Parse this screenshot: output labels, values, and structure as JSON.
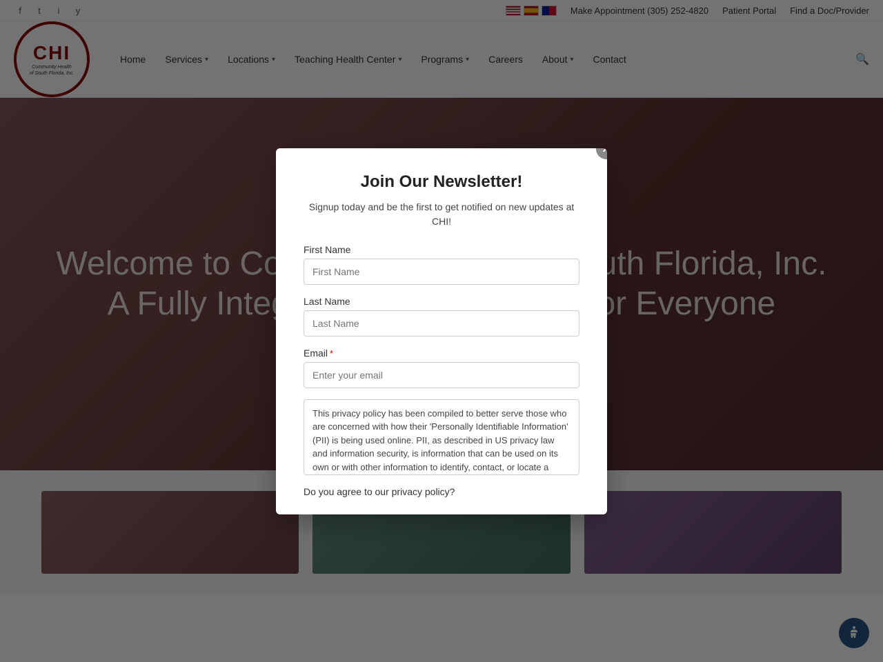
{
  "topbar": {
    "phone_link": "Make Appointment (305) 252-4820",
    "patient_portal_link": "Patient Portal",
    "find_doc_link": "Find a Doc/Provider"
  },
  "nav": {
    "home": "Home",
    "services": "Services",
    "locations": "Locations",
    "teaching_health_center": "Teaching Health Center",
    "programs": "Programs",
    "careers": "Careers",
    "about": "About",
    "contact": "Contact",
    "logo_line1": "CHI",
    "logo_line2": "Community Health",
    "logo_line3": "of South Florida, Inc."
  },
  "patient_portal_btn": "Patient\nPortal",
  "hero": {
    "line1": "Welcome to Community Health of South Florida, Inc.",
    "line2": "A Fully Integrated Health Center for Everyone"
  },
  "modal": {
    "title": "Join Our Newsletter!",
    "subtitle": "Signup today and be the first to get notified on new updates at CHI!",
    "first_name_label": "First Name",
    "first_name_placeholder": "First Name",
    "last_name_label": "Last Name",
    "last_name_placeholder": "Last Name",
    "email_label": "Email",
    "email_required": "*",
    "email_placeholder": "Enter your email",
    "privacy_text": "This privacy policy has been compiled to better serve those who are concerned with how their 'Personally Identifiable Information' (PII) is being used online. PII, as described in US privacy law and information security, is information that can be used on its own or with other information to identify, contact, or locate a single person, or to identify an individual in context.",
    "privacy_question": "Do you agree to our privacy policy?",
    "close_label": "X"
  }
}
